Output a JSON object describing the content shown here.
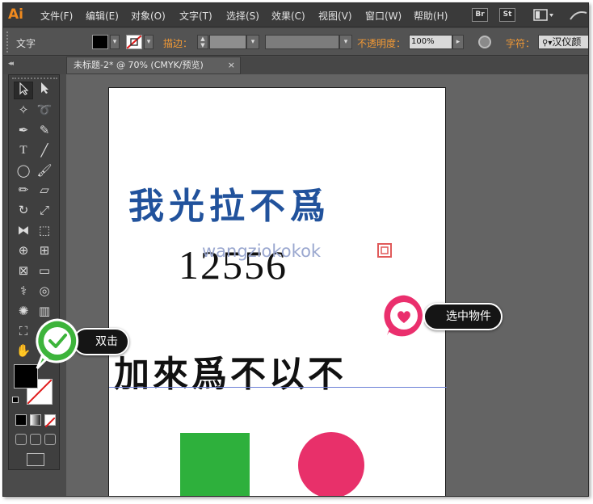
{
  "app": {
    "logo": "Ai"
  },
  "menubar": {
    "items": [
      "文件(F)",
      "编辑(E)",
      "对象(O)",
      "文字(T)",
      "选择(S)",
      "效果(C)",
      "视图(V)",
      "窗口(W)",
      "帮助(H)"
    ],
    "bridge_btn": "Br",
    "stock_btn": "St"
  },
  "controlbar": {
    "tool_label": "文字",
    "stroke_label": "描边：",
    "opacity_label": "不透明度：",
    "opacity_value": "100%",
    "char_label": "字符：",
    "font_value": "汉仪颜"
  },
  "document": {
    "tab_title": "未标题-2* @ 70% (CMYK/预览)",
    "close_glyph": "×"
  },
  "artboard": {
    "blue_text": "我光拉不爲",
    "number_text": "12556",
    "black_text": "加來爲不以不",
    "watermark": "wangziokokok"
  },
  "callouts": {
    "double_click": "双击",
    "select_object": "选中物件"
  },
  "colors": {
    "blue_text": "#21529c",
    "green_shape": "#2eb03c",
    "pink_shape": "#e8306a",
    "callout_green": "#3db43b",
    "callout_pink": "#ea2f6d",
    "accent_orange": "#f08a1e"
  }
}
